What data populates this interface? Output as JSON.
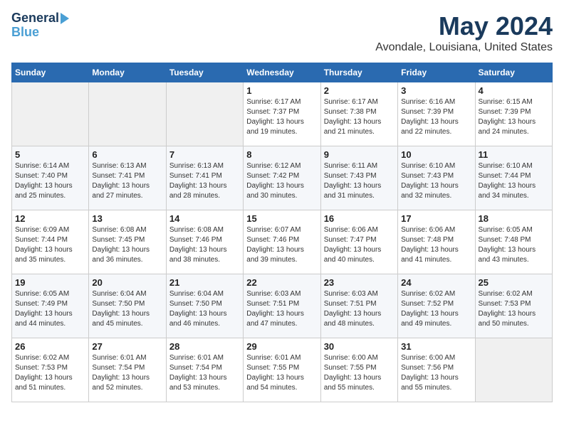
{
  "logo": {
    "line1": "General",
    "line2": "Blue"
  },
  "title": "May 2024",
  "location": "Avondale, Louisiana, United States",
  "days_header": [
    "Sunday",
    "Monday",
    "Tuesday",
    "Wednesday",
    "Thursday",
    "Friday",
    "Saturday"
  ],
  "weeks": [
    [
      {
        "num": "",
        "info": ""
      },
      {
        "num": "",
        "info": ""
      },
      {
        "num": "",
        "info": ""
      },
      {
        "num": "1",
        "info": "Sunrise: 6:17 AM\nSunset: 7:37 PM\nDaylight: 13 hours\nand 19 minutes."
      },
      {
        "num": "2",
        "info": "Sunrise: 6:17 AM\nSunset: 7:38 PM\nDaylight: 13 hours\nand 21 minutes."
      },
      {
        "num": "3",
        "info": "Sunrise: 6:16 AM\nSunset: 7:39 PM\nDaylight: 13 hours\nand 22 minutes."
      },
      {
        "num": "4",
        "info": "Sunrise: 6:15 AM\nSunset: 7:39 PM\nDaylight: 13 hours\nand 24 minutes."
      }
    ],
    [
      {
        "num": "5",
        "info": "Sunrise: 6:14 AM\nSunset: 7:40 PM\nDaylight: 13 hours\nand 25 minutes."
      },
      {
        "num": "6",
        "info": "Sunrise: 6:13 AM\nSunset: 7:41 PM\nDaylight: 13 hours\nand 27 minutes."
      },
      {
        "num": "7",
        "info": "Sunrise: 6:13 AM\nSunset: 7:41 PM\nDaylight: 13 hours\nand 28 minutes."
      },
      {
        "num": "8",
        "info": "Sunrise: 6:12 AM\nSunset: 7:42 PM\nDaylight: 13 hours\nand 30 minutes."
      },
      {
        "num": "9",
        "info": "Sunrise: 6:11 AM\nSunset: 7:43 PM\nDaylight: 13 hours\nand 31 minutes."
      },
      {
        "num": "10",
        "info": "Sunrise: 6:10 AM\nSunset: 7:43 PM\nDaylight: 13 hours\nand 32 minutes."
      },
      {
        "num": "11",
        "info": "Sunrise: 6:10 AM\nSunset: 7:44 PM\nDaylight: 13 hours\nand 34 minutes."
      }
    ],
    [
      {
        "num": "12",
        "info": "Sunrise: 6:09 AM\nSunset: 7:44 PM\nDaylight: 13 hours\nand 35 minutes."
      },
      {
        "num": "13",
        "info": "Sunrise: 6:08 AM\nSunset: 7:45 PM\nDaylight: 13 hours\nand 36 minutes."
      },
      {
        "num": "14",
        "info": "Sunrise: 6:08 AM\nSunset: 7:46 PM\nDaylight: 13 hours\nand 38 minutes."
      },
      {
        "num": "15",
        "info": "Sunrise: 6:07 AM\nSunset: 7:46 PM\nDaylight: 13 hours\nand 39 minutes."
      },
      {
        "num": "16",
        "info": "Sunrise: 6:06 AM\nSunset: 7:47 PM\nDaylight: 13 hours\nand 40 minutes."
      },
      {
        "num": "17",
        "info": "Sunrise: 6:06 AM\nSunset: 7:48 PM\nDaylight: 13 hours\nand 41 minutes."
      },
      {
        "num": "18",
        "info": "Sunrise: 6:05 AM\nSunset: 7:48 PM\nDaylight: 13 hours\nand 43 minutes."
      }
    ],
    [
      {
        "num": "19",
        "info": "Sunrise: 6:05 AM\nSunset: 7:49 PM\nDaylight: 13 hours\nand 44 minutes."
      },
      {
        "num": "20",
        "info": "Sunrise: 6:04 AM\nSunset: 7:50 PM\nDaylight: 13 hours\nand 45 minutes."
      },
      {
        "num": "21",
        "info": "Sunrise: 6:04 AM\nSunset: 7:50 PM\nDaylight: 13 hours\nand 46 minutes."
      },
      {
        "num": "22",
        "info": "Sunrise: 6:03 AM\nSunset: 7:51 PM\nDaylight: 13 hours\nand 47 minutes."
      },
      {
        "num": "23",
        "info": "Sunrise: 6:03 AM\nSunset: 7:51 PM\nDaylight: 13 hours\nand 48 minutes."
      },
      {
        "num": "24",
        "info": "Sunrise: 6:02 AM\nSunset: 7:52 PM\nDaylight: 13 hours\nand 49 minutes."
      },
      {
        "num": "25",
        "info": "Sunrise: 6:02 AM\nSunset: 7:53 PM\nDaylight: 13 hours\nand 50 minutes."
      }
    ],
    [
      {
        "num": "26",
        "info": "Sunrise: 6:02 AM\nSunset: 7:53 PM\nDaylight: 13 hours\nand 51 minutes."
      },
      {
        "num": "27",
        "info": "Sunrise: 6:01 AM\nSunset: 7:54 PM\nDaylight: 13 hours\nand 52 minutes."
      },
      {
        "num": "28",
        "info": "Sunrise: 6:01 AM\nSunset: 7:54 PM\nDaylight: 13 hours\nand 53 minutes."
      },
      {
        "num": "29",
        "info": "Sunrise: 6:01 AM\nSunset: 7:55 PM\nDaylight: 13 hours\nand 54 minutes."
      },
      {
        "num": "30",
        "info": "Sunrise: 6:00 AM\nSunset: 7:55 PM\nDaylight: 13 hours\nand 55 minutes."
      },
      {
        "num": "31",
        "info": "Sunrise: 6:00 AM\nSunset: 7:56 PM\nDaylight: 13 hours\nand 55 minutes."
      },
      {
        "num": "",
        "info": ""
      }
    ]
  ]
}
